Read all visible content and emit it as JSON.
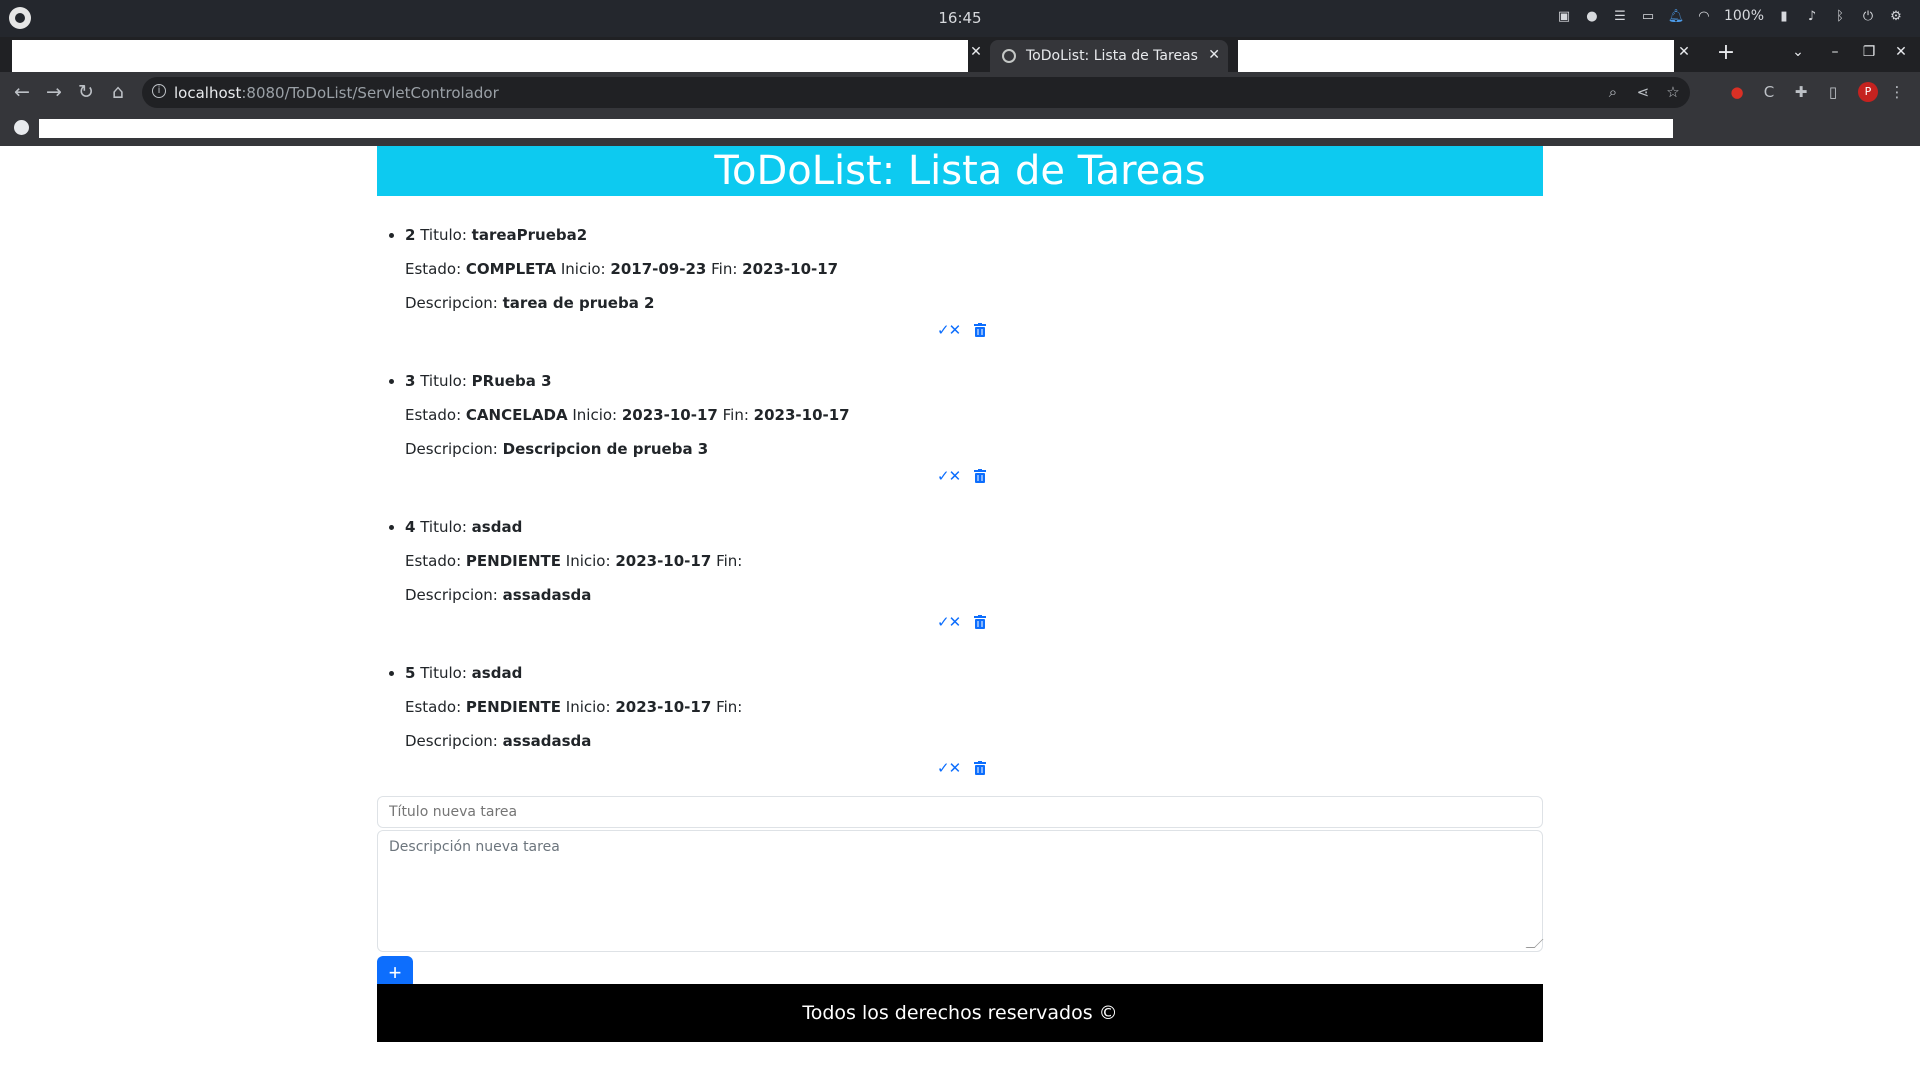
{
  "os": {
    "clock": "16:45",
    "battery": "100%"
  },
  "browser": {
    "active_tab_title": "ToDoList: Lista de Tareas",
    "url_host": "localhost",
    "url_path": ":8080/ToDoList/ServletControlador",
    "profile_initial": "P"
  },
  "page": {
    "header": "ToDoList: Lista de Tareas",
    "labels": {
      "titulo": "Titulo:",
      "estado": "Estado:",
      "inicio": "Inicio:",
      "fin": "Fin:",
      "descripcion": "Descripcion:"
    },
    "tasks": [
      {
        "id": "2",
        "titulo": "tareaPrueba2",
        "estado": "COMPLETA",
        "inicio": "2017-09-23",
        "fin": "2023-10-17",
        "descripcion": "tarea de prueba 2"
      },
      {
        "id": "3",
        "titulo": "PRueba 3",
        "estado": "CANCELADA",
        "inicio": "2023-10-17",
        "fin": "2023-10-17",
        "descripcion": "Descripcion de prueba 3"
      },
      {
        "id": "4",
        "titulo": "asdad",
        "estado": "PENDIENTE",
        "inicio": "2023-10-17",
        "fin": "",
        "descripcion": "assadasda"
      },
      {
        "id": "5",
        "titulo": "asdad",
        "estado": "PENDIENTE",
        "inicio": "2023-10-17",
        "fin": "",
        "descripcion": "assadasda"
      }
    ],
    "form": {
      "title_placeholder": "Título nueva tarea",
      "desc_placeholder": "Descripción nueva tarea",
      "add_label": "+"
    },
    "footer": "Todos los derechos reservados ©"
  }
}
